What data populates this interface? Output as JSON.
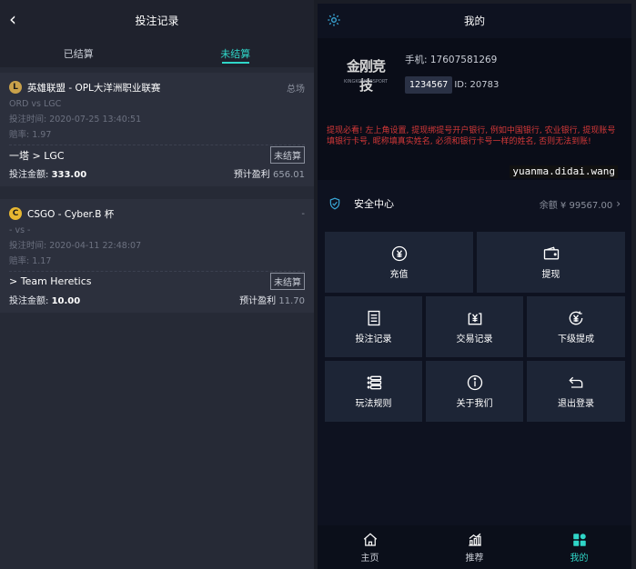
{
  "left": {
    "header": {
      "title": "投注记录",
      "back_icon": "back-arrow-icon"
    },
    "tabs": [
      {
        "label": "已结算",
        "active": false
      },
      {
        "label": "未结算",
        "active": true
      }
    ],
    "cards": [
      {
        "game_icon": "lol-icon",
        "title": "英雄联盟 - OPL大洋洲职业联赛",
        "type": "总场",
        "teams": "ORD vs LGC",
        "time": "投注时间: 2020-07-25 13:40:51",
        "odds": "赔率: 1.97",
        "pick": "一塔 > LGC",
        "status": "未结算",
        "stake_label": "投注金额:",
        "stake": "333.00",
        "profit_label": "预计盈利",
        "profit": "656.01"
      },
      {
        "game_icon": "csgo-icon",
        "title": "CSGO - Cyber.B 杯",
        "type": "-",
        "teams": "- vs -",
        "time": "投注时间: 2020-04-11 22:48:07",
        "odds": "赔率: 1.17",
        "pick": "> Team Heretics",
        "status": "未结算",
        "stake_label": "投注金额:",
        "stake": "10.00",
        "profit_label": "预计盈利",
        "profit": "11.70"
      }
    ]
  },
  "right": {
    "header": {
      "title": "我的",
      "settings_icon": "gear-icon"
    },
    "profile": {
      "logo_text": "金刚竞技",
      "logo_sub": "KINGKONG ESPORT",
      "phone": "手机: 17607581269",
      "id_badge": "1234567",
      "id_text": "ID: 20783"
    },
    "notice": "提现必看! 左上角设置, 提现绑提号开户银行, 例如中国银行, 农业银行, 提现账号填银行卡号, 昵称填真实姓名, 必须和银行卡号一样的姓名, 否则无法到账!",
    "watermark": "yuanma.didai.wang",
    "security": {
      "label": "安全中心",
      "balance": "余额 ¥ 99567.00"
    },
    "buttons": [
      {
        "label": "充值",
        "icon": "deposit-icon"
      },
      {
        "label": "提现",
        "icon": "wallet-icon"
      },
      {
        "label": "投注记录",
        "icon": "bet-record-icon"
      },
      {
        "label": "交易记录",
        "icon": "transaction-icon"
      },
      {
        "label": "下级提成",
        "icon": "commission-icon"
      },
      {
        "label": "玩法规则",
        "icon": "rules-icon"
      },
      {
        "label": "关于我们",
        "icon": "info-icon"
      },
      {
        "label": "退出登录",
        "icon": "logout-icon"
      }
    ],
    "nav": [
      {
        "label": "主页",
        "icon": "home-icon",
        "active": false
      },
      {
        "label": "推荐",
        "icon": "trend-icon",
        "active": false
      },
      {
        "label": "我的",
        "icon": "profile-grid-icon",
        "active": true
      }
    ]
  },
  "colors": {
    "accent": "#2fd6c8",
    "notice": "#d33838",
    "panel": "#262a36"
  }
}
